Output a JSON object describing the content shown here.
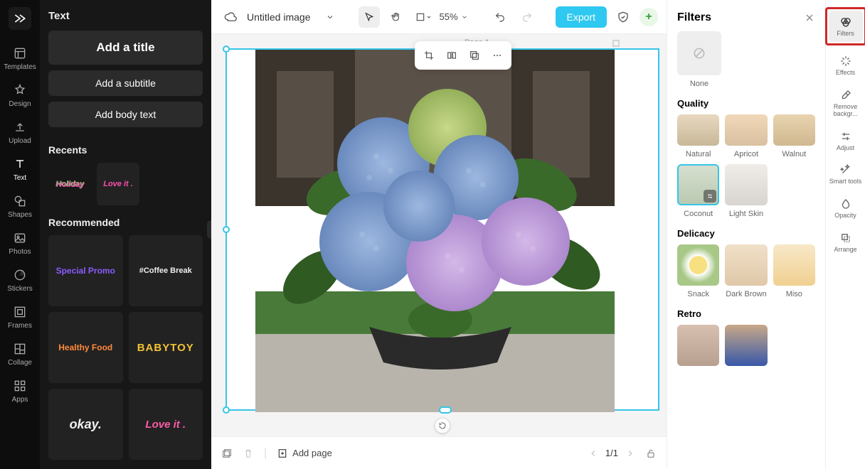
{
  "rail": {
    "items": [
      {
        "label": "Templates",
        "name": "templates"
      },
      {
        "label": "Design",
        "name": "design"
      },
      {
        "label": "Upload",
        "name": "upload"
      },
      {
        "label": "Text",
        "name": "text"
      },
      {
        "label": "Shapes",
        "name": "shapes"
      },
      {
        "label": "Photos",
        "name": "photos"
      },
      {
        "label": "Stickers",
        "name": "stickers"
      },
      {
        "label": "Frames",
        "name": "frames"
      },
      {
        "label": "Collage",
        "name": "collage"
      },
      {
        "label": "Apps",
        "name": "apps"
      }
    ],
    "active_index": 3
  },
  "left_panel": {
    "title": "Text",
    "add_title": "Add a title",
    "add_subtitle": "Add a subtitle",
    "add_body": "Add body text",
    "recents_title": "Recents",
    "recents": [
      {
        "text": "Holiday",
        "color1": "#6bd36b",
        "color2": "#ff4fb0"
      },
      {
        "text": "Love it .",
        "color": "#ff4fb0"
      }
    ],
    "recommended_title": "Recommended",
    "recommended": [
      {
        "text": "Special Promo",
        "color": "#8a5cff"
      },
      {
        "text": "#Coffee Break",
        "color": "#eee"
      },
      {
        "text": "Healthy Food",
        "color": "#ff8a3d"
      },
      {
        "text": "BABYTOY",
        "color": "#f2c335"
      },
      {
        "text": "okay.",
        "color": "#f0f0f0"
      },
      {
        "text": "Love it .",
        "color": "#ff5ca8"
      }
    ]
  },
  "topbar": {
    "doc_title": "Untitled image",
    "zoom": "55%",
    "export": "Export"
  },
  "canvas": {
    "page_label": "Page 1"
  },
  "bottombar": {
    "add_page": "Add page",
    "pager": "1/1"
  },
  "filters": {
    "title": "Filters",
    "none_label": "None",
    "sections": [
      {
        "title": "Quality",
        "items": [
          {
            "label": "Natural"
          },
          {
            "label": "Apricot"
          },
          {
            "label": "Walnut"
          },
          {
            "label": "Coconut",
            "selected": true,
            "has_ctrl": true
          },
          {
            "label": "Light Skin"
          }
        ]
      },
      {
        "title": "Delicacy",
        "items": [
          {
            "label": "Snack"
          },
          {
            "label": "Dark Brown"
          },
          {
            "label": "Miso"
          }
        ]
      },
      {
        "title": "Retro",
        "items": [
          {
            "label": ""
          },
          {
            "label": ""
          }
        ]
      }
    ]
  },
  "right_rail": {
    "items": [
      {
        "label": "Filters",
        "name": "filters",
        "highlighted": true
      },
      {
        "label": "Effects",
        "name": "effects"
      },
      {
        "label": "Remove backgr...",
        "name": "remove-bg"
      },
      {
        "label": "Adjust",
        "name": "adjust"
      },
      {
        "label": "Smart tools",
        "name": "smart-tools"
      },
      {
        "label": "Opacity",
        "name": "opacity"
      },
      {
        "label": "Arrange",
        "name": "arrange"
      }
    ]
  }
}
